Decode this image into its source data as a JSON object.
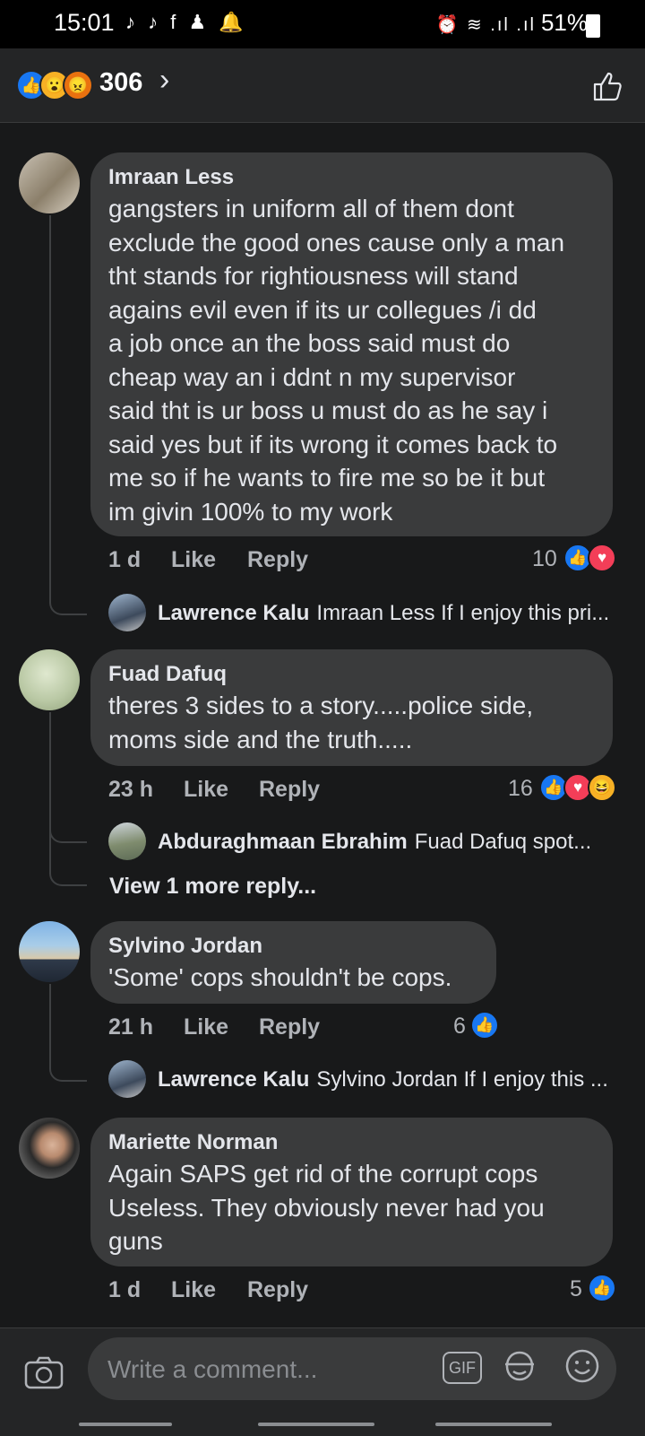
{
  "status_bar": {
    "time": "15:01",
    "notification_icons": "♪ ♪ f ♟ 🔔",
    "signal_icons": "⏰ ≋ .ıl .ıl",
    "battery_text": "51%"
  },
  "header": {
    "reaction_count": "306",
    "reaction_icons": [
      "like-icon",
      "wow-icon",
      "angry-icon"
    ]
  },
  "comments": [
    {
      "author": "Imraan Less",
      "text": "gangsters in uniform  all of them  dont\nexclude the good ones cause only a man\ntht stands for rightiousness will stand\nagains evil even if its ur collegues   /i dd\na job once an the boss said must do\ncheap way an i ddnt n my supervisor\nsaid tht is ur boss u must do as he say  i\nsaid yes but if its wrong it comes back to\nme  so if he wants to fire me so be it   but\nim givin 100% to my work",
      "time": "1 d",
      "like_label": "Like",
      "reply_label": "Reply",
      "reaction_count": "10",
      "reactions": [
        "like-icon",
        "love-icon"
      ],
      "replies": [
        {
          "author": "Lawrence Kalu",
          "snippet": "Imraan Less If I enjoy this pri..."
        }
      ]
    },
    {
      "author": "Fuad Dafuq",
      "text": "theres 3 sides to a story.....police side,\nmoms side and the truth.....",
      "time": "23 h",
      "like_label": "Like",
      "reply_label": "Reply",
      "reaction_count": "16",
      "reactions": [
        "like-icon",
        "love-icon",
        "haha-icon"
      ],
      "replies": [
        {
          "author": "Abduraghmaan Ebrahim",
          "snippet": "Fuad Dafuq spot..."
        }
      ],
      "more_replies": "View 1 more reply..."
    },
    {
      "author": "Sylvino Jordan",
      "text": "'Some' cops shouldn't be cops.",
      "time": "21 h",
      "like_label": "Like",
      "reply_label": "Reply",
      "reaction_count": "6",
      "reactions": [
        "like-icon"
      ],
      "replies": [
        {
          "author": "Lawrence Kalu",
          "snippet": "Sylvino Jordan If I enjoy this ..."
        }
      ]
    },
    {
      "author": "Mariette Norman",
      "text": "Again SAPS get rid of the corrupt cops\nUseless. They obviously never had you\nguns",
      "time": "1 d",
      "like_label": "Like",
      "reply_label": "Reply",
      "reaction_count": "5",
      "reactions": [
        "like-icon"
      ]
    }
  ],
  "composer": {
    "placeholder": "Write a comment...",
    "gif_label": "GIF"
  },
  "colors": {
    "background": "#18191a",
    "bubble": "#3a3b3c",
    "like_blue": "#1877f2",
    "love_red": "#f33e58",
    "secondary_text": "#b0b3b8"
  }
}
